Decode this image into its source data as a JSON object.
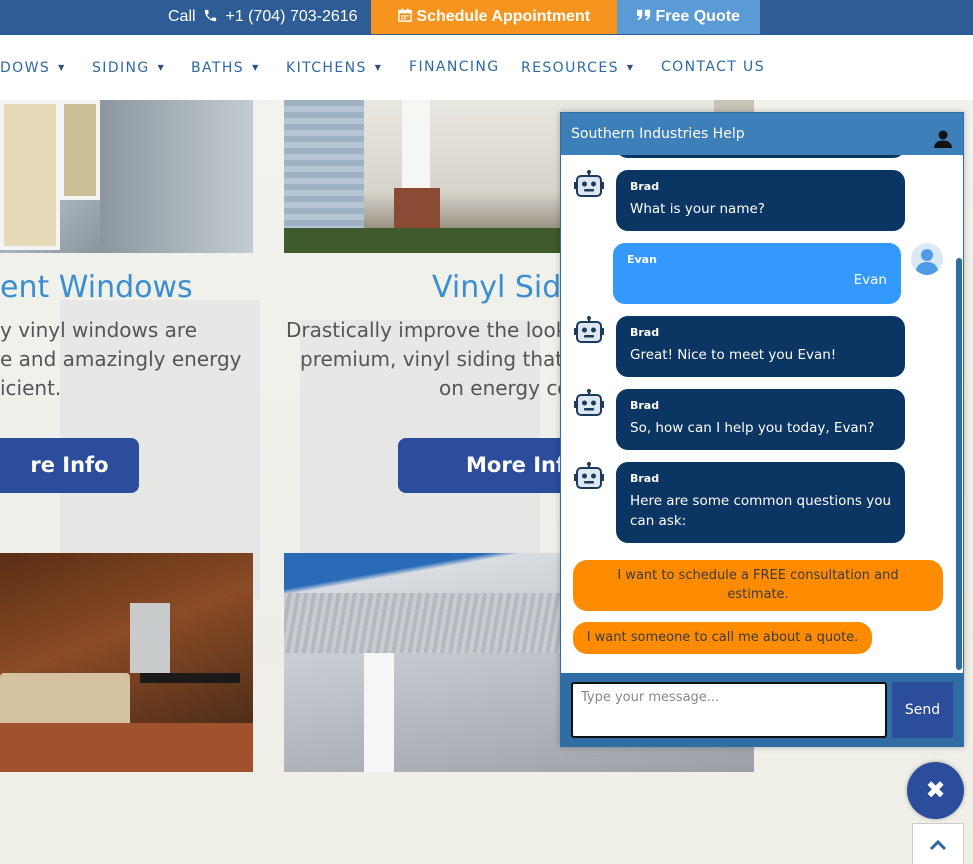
{
  "topbar": {
    "call_label": "Call",
    "phone": "+1 (704) 703-2616",
    "schedule_label": "Schedule Appointment",
    "quote_label": "Free Quote",
    "colors": {
      "bar": "#2e5d96",
      "schedule": "#f7941d",
      "quote": "#5b9bd5"
    }
  },
  "nav": {
    "items": [
      {
        "label": "DOWS",
        "dropdown": true
      },
      {
        "label": "SIDING",
        "dropdown": true
      },
      {
        "label": "BATHS",
        "dropdown": true
      },
      {
        "label": "KITCHENS",
        "dropdown": true
      },
      {
        "label": "FINANCING",
        "dropdown": false
      },
      {
        "label": "RESOURCES",
        "dropdown": true
      },
      {
        "label": "CONTACT US",
        "dropdown": false
      }
    ]
  },
  "cards": [
    {
      "title": "ent Windows",
      "text_lines": [
        "y vinyl windows are",
        "e and amazingly energy",
        "icient."
      ],
      "button": "re Info"
    },
    {
      "title": "Vinyl Sid",
      "text_lines": [
        "Drastically improve the look",
        "premium, vinyl siding that",
        "on energy co"
      ],
      "button": "More Inf"
    }
  ],
  "chat": {
    "header_title": "Southern Industries Help",
    "messages": [
      {
        "from": "bot",
        "name": "Brad",
        "text": "What is your name?"
      },
      {
        "from": "user",
        "name": "Evan",
        "text": "Evan"
      },
      {
        "from": "bot",
        "name": "Brad",
        "text": "Great! Nice to meet you Evan!"
      },
      {
        "from": "bot",
        "name": "Brad",
        "text": "So, how can I help you today, Evan?"
      },
      {
        "from": "bot",
        "name": "Brad",
        "text": "Here are some common questions you can ask:"
      }
    ],
    "quick_replies": [
      "I want to schedule a FREE consultation and estimate.",
      "I want someone to call me about a quote."
    ],
    "input_placeholder": "Type your message...",
    "send_label": "Send",
    "colors": {
      "bot_bubble": "#0b3563",
      "user_bubble": "#3399ff",
      "quick_reply": "#ff8c00",
      "header": "#3d7fb8"
    }
  },
  "icons": {
    "phone": "phone-icon",
    "calendar": "calendar-icon",
    "quote": "quote-icon",
    "person": "person-icon",
    "robot": "robot-icon",
    "close": "close-icon",
    "up": "chevron-up-icon"
  },
  "fab": {
    "close_glyph": "✖"
  }
}
